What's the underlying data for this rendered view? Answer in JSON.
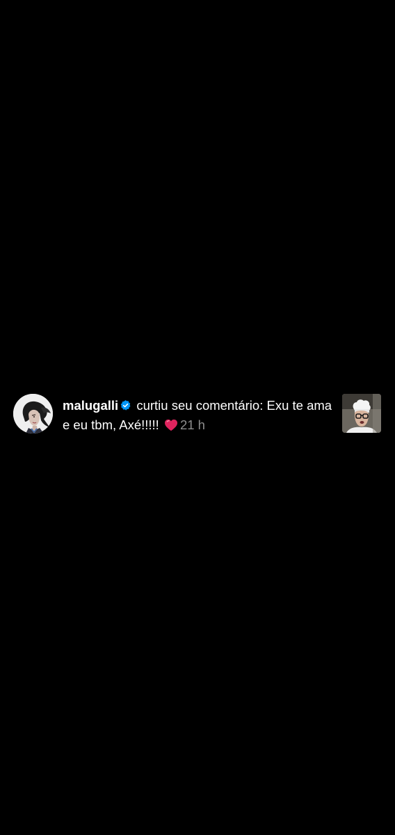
{
  "notification": {
    "avatar_icon": "profile-photo",
    "username": "malugalli",
    "verified_icon": "verified-badge-icon",
    "action_text": "curtiu seu comentário: Exu te ama e eu tbm, Axé!!!!!",
    "reaction_icon": "red-heart-emoji",
    "timestamp": "21 h",
    "thumbnail_icon": "post-thumbnail"
  },
  "colors": {
    "background": "#000000",
    "text": "#ffffff",
    "timestamp": "#8e8e8e",
    "verified": "#0095f6",
    "heart": "#e0245e"
  }
}
